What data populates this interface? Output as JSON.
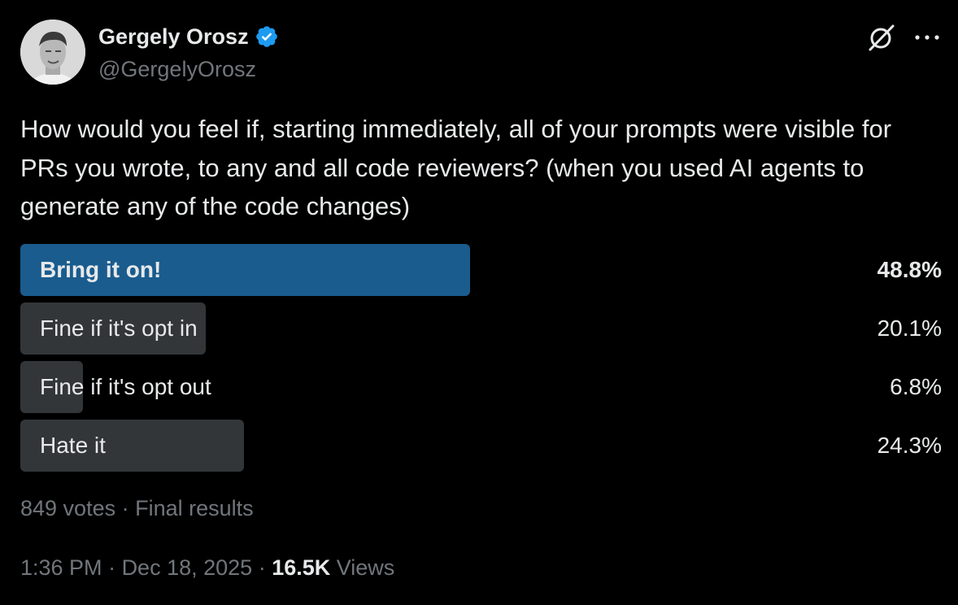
{
  "author": {
    "display_name": "Gergely Orosz",
    "handle": "@GergelyOrosz",
    "verified": true,
    "verified_color": "#1d9bf0"
  },
  "header_icons": {
    "grok": "grok-icon",
    "more": "more-icon"
  },
  "post": {
    "text": "How would you feel if, starting immediately, all of your prompts were visible for PRs you wrote, to any and all code reviewers? (when you used AI agents to generate any of the code changes)"
  },
  "poll": {
    "options": [
      {
        "label": "Bring it on!",
        "percent": "48.8%",
        "value": 48.8,
        "winner": true
      },
      {
        "label": "Fine if it's opt in",
        "percent": "20.1%",
        "value": 20.1,
        "winner": false
      },
      {
        "label": "Fine if it's opt out",
        "percent": "6.8%",
        "value": 6.8,
        "winner": false
      },
      {
        "label": "Hate it",
        "percent": "24.3%",
        "value": 24.3,
        "winner": false
      }
    ],
    "votes": "849 votes",
    "separator": " · ",
    "status": "Final results",
    "winner_color": "#1a5c8e",
    "bar_color": "#333639"
  },
  "meta": {
    "time": "1:36 PM",
    "separator": " · ",
    "date": "Dec 18, 2025",
    "views_count": "16.5K",
    "views_label": "Views"
  }
}
